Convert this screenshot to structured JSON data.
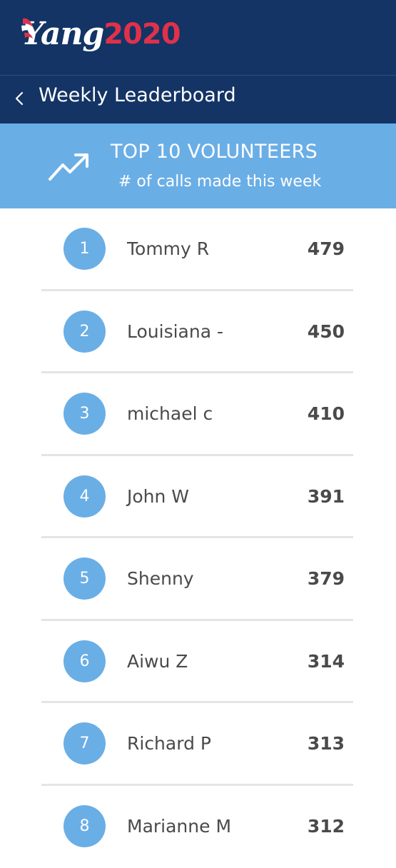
{
  "header": {
    "logo_text": "Yang",
    "logo_year": "2020",
    "title": "Weekly Leaderboard"
  },
  "banner": {
    "title": "TOP 10 VOLUNTEERS",
    "subtitle": "# of calls made this week",
    "icon": "trending-up-icon"
  },
  "leaderboard": [
    {
      "rank": "1",
      "name": "Tommy R",
      "calls": "479"
    },
    {
      "rank": "2",
      "name": "Louisiana -",
      "calls": "450"
    },
    {
      "rank": "3",
      "name": "michael c",
      "calls": "410"
    },
    {
      "rank": "4",
      "name": "John W",
      "calls": "391"
    },
    {
      "rank": "5",
      "name": "Shenny",
      "calls": "379"
    },
    {
      "rank": "6",
      "name": "Aiwu Z",
      "calls": "314"
    },
    {
      "rank": "7",
      "name": "Richard P",
      "calls": "313"
    },
    {
      "rank": "8",
      "name": "Marianne M",
      "calls": "312"
    }
  ],
  "colors": {
    "header_bg": "#133465",
    "banner_bg": "#6aaee6",
    "accent_red": "#e0314a",
    "rank_circle": "#6aaee6"
  }
}
